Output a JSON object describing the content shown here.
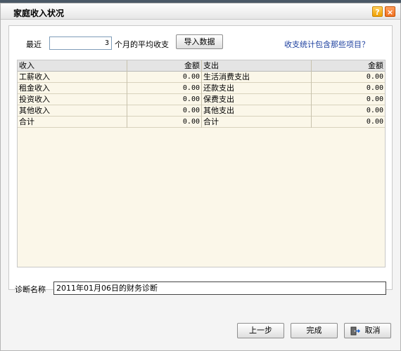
{
  "window": {
    "title": "家庭收入状况",
    "help_icon": "?",
    "close_icon": "×"
  },
  "filter": {
    "prefix_label": "最近",
    "months_value": "3",
    "suffix_label": "个月的平均收支",
    "import_button": "导入数据",
    "help_link": "收支统计包含那些项目？"
  },
  "table": {
    "headers": [
      "收入",
      "金额",
      "支出",
      "金额"
    ],
    "rows": [
      [
        "工薪收入",
        "0.00",
        "生活消费支出",
        "0.00"
      ],
      [
        "租金收入",
        "0.00",
        "还款支出",
        "0.00"
      ],
      [
        "投资收入",
        "0.00",
        "保费支出",
        "0.00"
      ],
      [
        "其他收入",
        "0.00",
        "其他支出",
        "0.00"
      ],
      [
        "合计",
        "0.00",
        "合计",
        "0.00"
      ]
    ]
  },
  "diagnosis": {
    "label": "诊断名称",
    "value": "2011年01月06日的财务诊断"
  },
  "footer": {
    "prev_button": "上一步",
    "finish_button": "完成",
    "cancel_button": "取消",
    "cancel_icon": "exit-door-icon"
  }
}
